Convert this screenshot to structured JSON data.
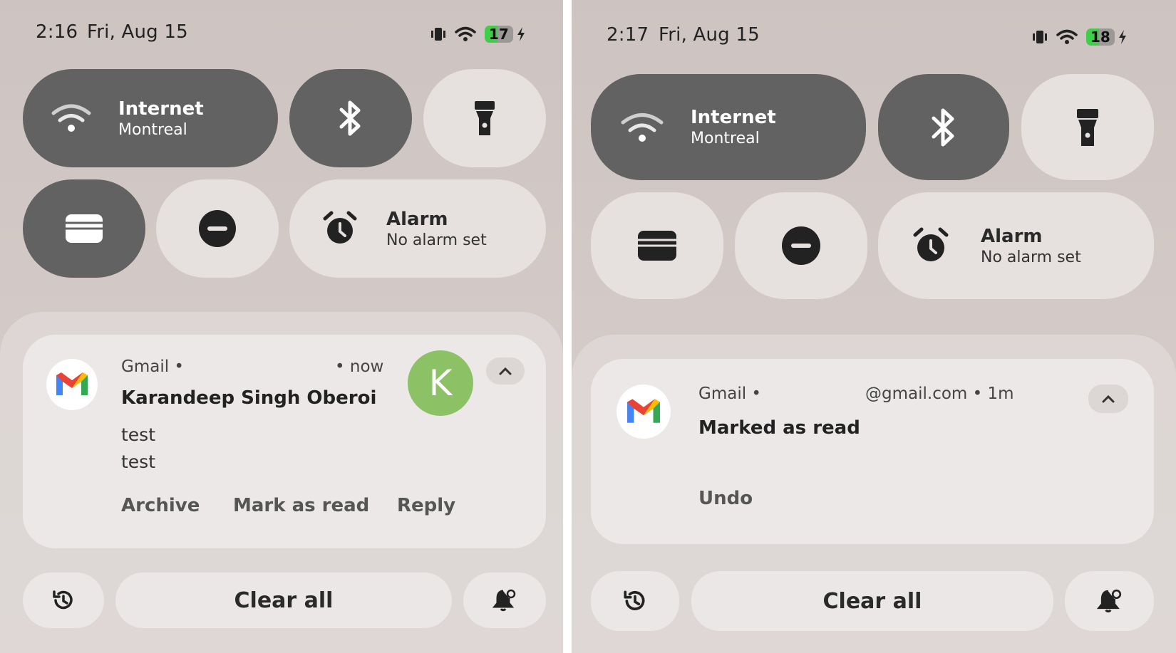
{
  "left": {
    "status": {
      "time": "2:16",
      "date": "Fri, Aug 15",
      "battery": "17"
    },
    "tiles": {
      "internet": {
        "title": "Internet",
        "subtitle": "Montreal"
      },
      "alarm": {
        "title": "Alarm",
        "subtitle": "No alarm set"
      }
    },
    "notification": {
      "app": "Gmail",
      "dot": "•",
      "time": "• now",
      "sender": "Karandeep Singh Oberoi",
      "body": [
        "test",
        "test"
      ],
      "avatar_letter": "K",
      "actions": [
        "Archive",
        "Mark as read",
        "Reply"
      ]
    },
    "clear_all": "Clear all"
  },
  "right": {
    "status": {
      "time": "2:17",
      "date": "Fri, Aug 15",
      "battery": "18"
    },
    "tiles": {
      "internet": {
        "title": "Internet",
        "subtitle": "Montreal"
      },
      "alarm": {
        "title": "Alarm",
        "subtitle": "No alarm set"
      }
    },
    "notification": {
      "app": "Gmail",
      "dot": "•",
      "account": "@gmail.com • 1m",
      "title": "Marked as read",
      "action": "Undo"
    },
    "clear_all": "Clear all"
  },
  "colors": {
    "tile_active": "#626262",
    "tile_inactive": "#e6e0de",
    "battery_fill": "#3fce4a",
    "avatar": "#8cc265"
  }
}
